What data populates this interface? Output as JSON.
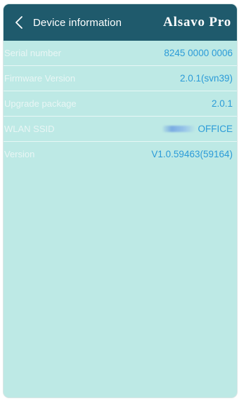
{
  "header": {
    "title": "Device information",
    "brand": "Alsavo Pro"
  },
  "rows": [
    {
      "label": "Serial number",
      "value": "8245 0000 0006"
    },
    {
      "label": "Firmware Version",
      "value": "2.0.1(svn39)"
    },
    {
      "label": "Upgrade package",
      "value": "2.0.1"
    },
    {
      "label": "WLAN SSID",
      "value": "OFFICE"
    },
    {
      "label": "Version",
      "value": "V1.0.59463(59164)"
    }
  ],
  "colors": {
    "header": "#1f5a6c",
    "background": "#bde9e5",
    "value_text": "#2b9bd8",
    "label_text": "#e9f6f5"
  },
  "icons": {
    "back": "chevron-left-icon"
  }
}
